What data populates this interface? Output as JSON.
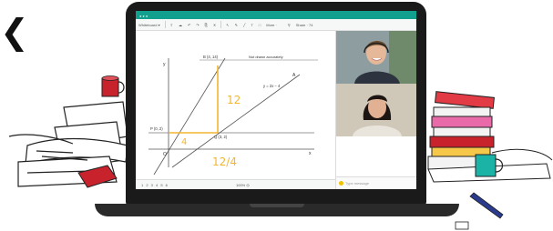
{
  "toolbar": {
    "whiteboard": "Whiteboard ▾",
    "more": "More ·",
    "share": "Share · 74"
  },
  "board": {
    "point_b": "B (4, 14)",
    "note": "Not drawn accurately",
    "equation": "y = 2x − 4",
    "point_p": "P (0, 2)",
    "point_q": "Q (3, 2)",
    "label_y": "y",
    "label_x": "x",
    "label_o": "O",
    "label_a": "A",
    "hand_12": "12",
    "hand_4": "4",
    "hand_fraction": "12/4"
  },
  "bottombar": {
    "pages": "1 2 3 4 5 6",
    "zoom": "100% ◎"
  },
  "chat": {
    "placeholder": "Type message"
  },
  "colors": {
    "teal": "#11a08d",
    "annotation": "#f2b632"
  }
}
